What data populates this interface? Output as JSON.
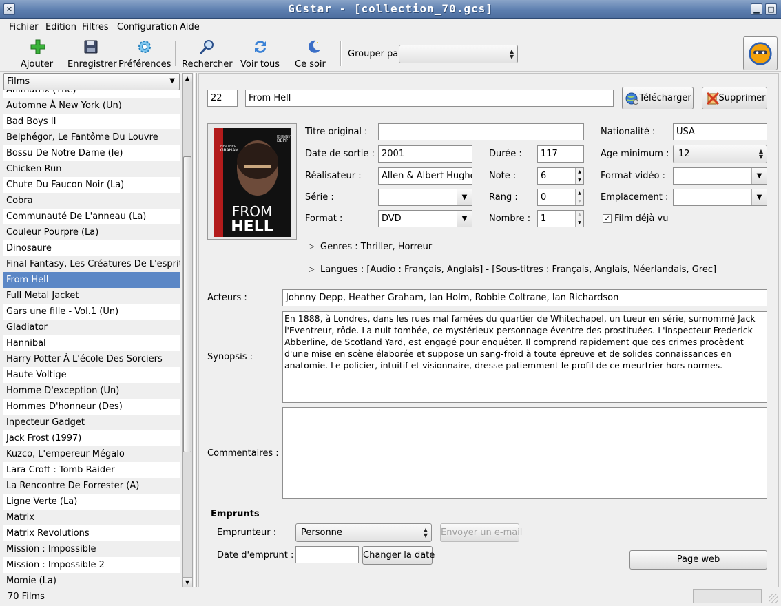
{
  "window": {
    "title": "GCstar - [collection_70.gcs]",
    "close_glyph": "✕",
    "min_glyph": "▁",
    "max_glyph": "□"
  },
  "menu": [
    "Fichier",
    "Edition",
    "Filtres",
    "Configuration",
    "Aide"
  ],
  "toolbar": {
    "add": "Ajouter",
    "save": "Enregistrer",
    "prefs": "Préférences",
    "search": "Rechercher",
    "view_all": "Voir tous",
    "tonight": "Ce soir",
    "group_by": "Grouper par",
    "group_value": ""
  },
  "sidebar": {
    "selector": "Films",
    "items": [
      "Animatrix (The)",
      "Automne À New York (Un)",
      "Bad Boys II",
      "Belphégor, Le Fantôme Du Louvre",
      "Bossu De Notre Dame (le)",
      "Chicken Run",
      "Chute Du Faucon Noir (La)",
      "Cobra",
      "Communauté De L'anneau (La)",
      "Couleur Pourpre (La)",
      "Dinosaure",
      "Final Fantasy, Les Créatures De L'esprit",
      "From Hell",
      "Full Metal Jacket",
      "Gars une fille - Vol.1  (Un)",
      "Gladiator",
      "Hannibal",
      "Harry Potter À L'école Des Sorciers",
      "Haute Voltige",
      "Homme D'exception (Un)",
      "Hommes D'honneur (Des)",
      "Inpecteur Gadget",
      "Jack Frost (1997)",
      "Kuzco, L'empereur Mégalo",
      "Lara Croft : Tomb Raider",
      "La Rencontre De Forrester (A)",
      "Ligne Verte (La)",
      "Matrix",
      "Matrix Revolutions",
      "Mission : Impossible",
      "Mission : Impossible 2",
      "Momie (La)"
    ],
    "selected_index": 12
  },
  "detail": {
    "id": "22",
    "title": "From Hell",
    "download": "Télécharger",
    "delete": "Supprimer",
    "poster": {
      "top_names": "JOHNNY DEPP  HEATHER GRAHAM",
      "title_line1": "FROM",
      "title_line2": "HELL",
      "accent": "#b31b1b"
    },
    "fields": {
      "original_title_label": "Titre original :",
      "original_title": "",
      "release_label": "Date de sortie :",
      "release": "2001",
      "director_label": "Réalisateur :",
      "director": "Allen & Albert Hughes",
      "series_label": "Série :",
      "series": "",
      "format_label": "Format :",
      "format": "DVD",
      "duration_label": "Durée :",
      "duration": "117",
      "rating_label": "Note :",
      "rating": "6",
      "rank_label": "Rang :",
      "rank": "0",
      "number_label": "Nombre :",
      "number": "1",
      "nationality_label": "Nationalité :",
      "nationality": "USA",
      "age_label": "Age minimum :",
      "age": "12",
      "video_label": "Format vidéo :",
      "video": "",
      "location_label": "Emplacement :",
      "location": "",
      "seen_label": "Film déjà vu"
    },
    "genres": "Genres : Thriller, Horreur",
    "languages": "Langues : [Audio : Français, Anglais] - [Sous-titres : Français, Anglais, Néerlandais, Grec]",
    "actors_label": "Acteurs :",
    "actors": "Johnny Depp, Heather Graham, Ian Holm, Robbie Coltrane, Ian Richardson",
    "synopsis_label": "Synopsis :",
    "synopsis": "En 1888, à Londres, dans les rues mal famées du quartier de Whitechapel, un tueur en série, surnommé Jack l'Eventreur, rôde. La nuit tombée, ce mystérieux personnage éventre des prostituées. L'inspecteur Frederick Abberline, de Scotland Yard, est engagé pour enquêter. Il comprend rapidement que ces crimes procèdent d'une mise en scène élaborée et suppose un sang-froid à toute épreuve et de solides connaissances en anatomie. Le policier, intuitif et visionnaire, dresse patiemment le profil de ce meurtrier hors normes.",
    "comments_label": "Commentaires :",
    "comments": ""
  },
  "loans": {
    "heading": "Emprunts",
    "borrower_label": "Emprunteur :",
    "borrower": "Personne",
    "email": "Envoyer un e-mail",
    "date_label": "Date d'emprunt :",
    "date": "",
    "change_date": "Changer la date",
    "web_page": "Page web"
  },
  "status": {
    "count": "70 Films"
  }
}
